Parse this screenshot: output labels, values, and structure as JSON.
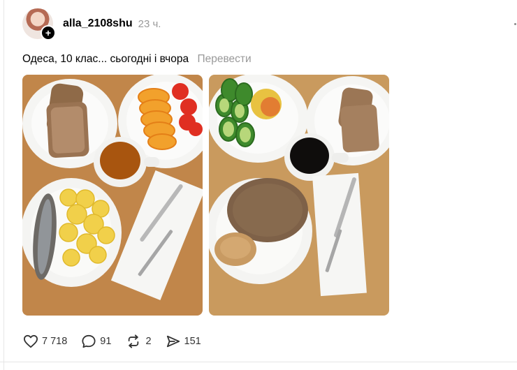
{
  "post": {
    "username": "alla_2108shu",
    "time": "23 ч.",
    "caption": "Одеса, 10 клас... сьогодні і вчора",
    "translate": "Перевести"
  },
  "actions": {
    "likes": "7 718",
    "comments": "91",
    "reposts": "2",
    "shares": "151"
  },
  "icons": {
    "like": "heart-icon",
    "comment": "speech-bubble-icon",
    "repost": "repost-arrows-icon",
    "share": "paper-plane-icon",
    "follow": "plus-icon"
  }
}
